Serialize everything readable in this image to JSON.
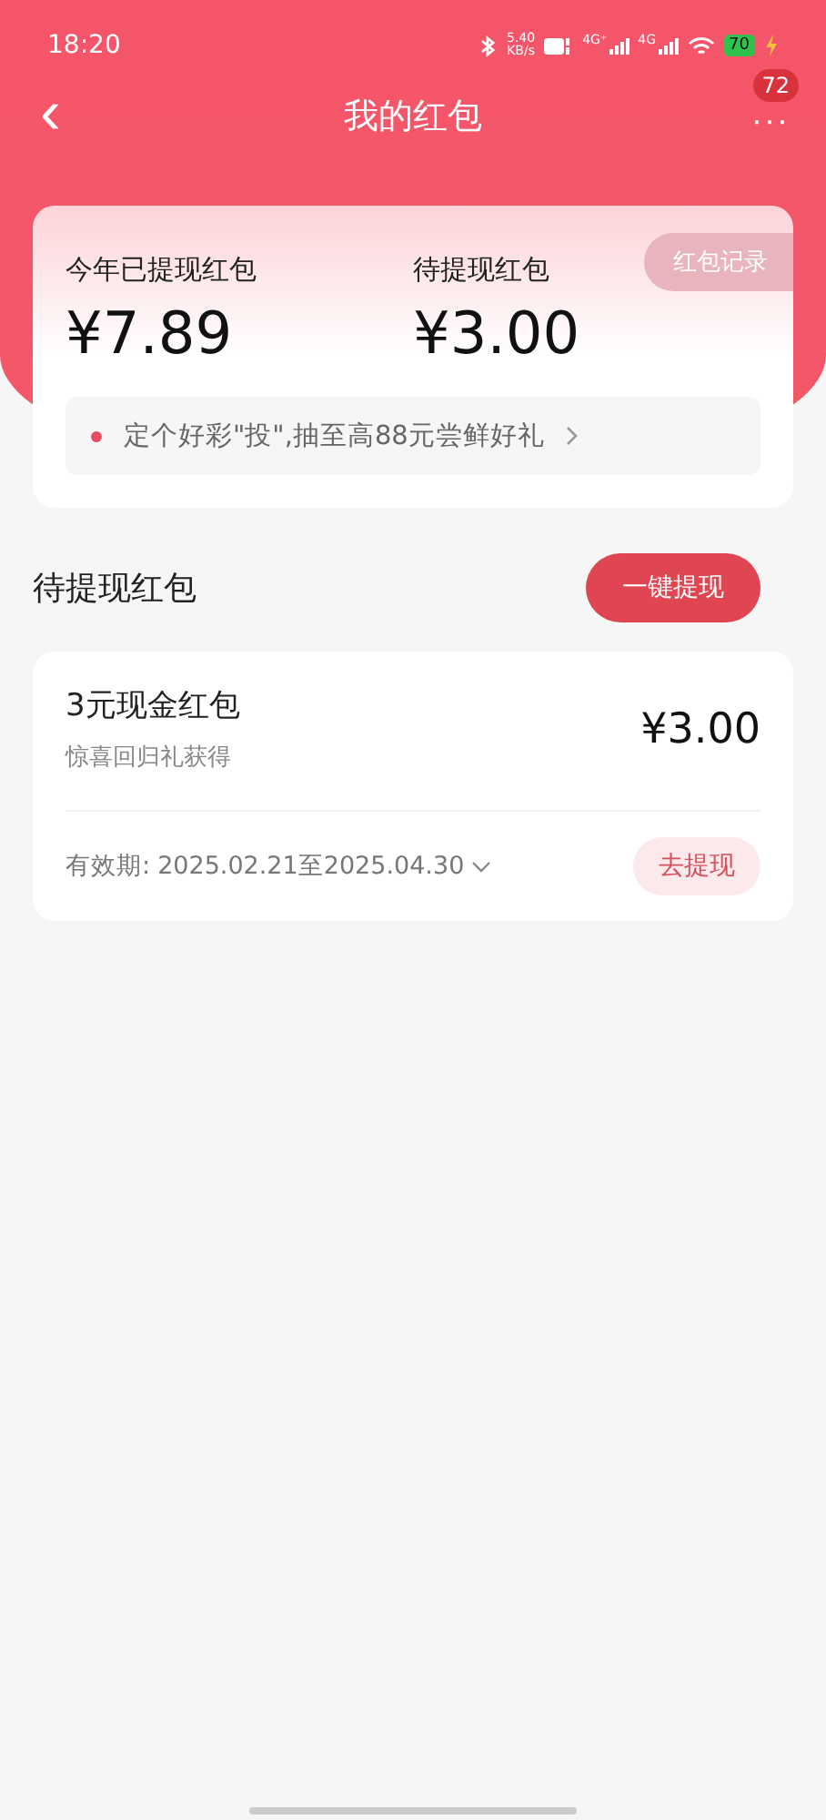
{
  "status_bar": {
    "time": "18:20",
    "net_speed": "5.40",
    "net_unit": "KB/s",
    "signal_1": "4G⁺",
    "signal_2": "4G",
    "battery": "70"
  },
  "nav": {
    "back": "‹",
    "title": "我的红包",
    "more": "···",
    "badge": "72"
  },
  "summary": {
    "record_button": "红包记录",
    "stats": [
      {
        "label": "今年已提现红包",
        "amount": "¥7.89"
      },
      {
        "label": "待提现红包",
        "amount": "¥3.00"
      }
    ],
    "promo": {
      "text": "定个好彩\"投\",抽至高88元尝鲜好礼"
    }
  },
  "section": {
    "title": "待提现红包",
    "action": "一键提现"
  },
  "packets": [
    {
      "name": "3元现金红包",
      "source": "惊喜回归礼获得",
      "amount": "¥3.00",
      "validity_label": "有效期:",
      "validity": "2025.02.21至2025.04.30",
      "action": "去提现"
    }
  ]
}
